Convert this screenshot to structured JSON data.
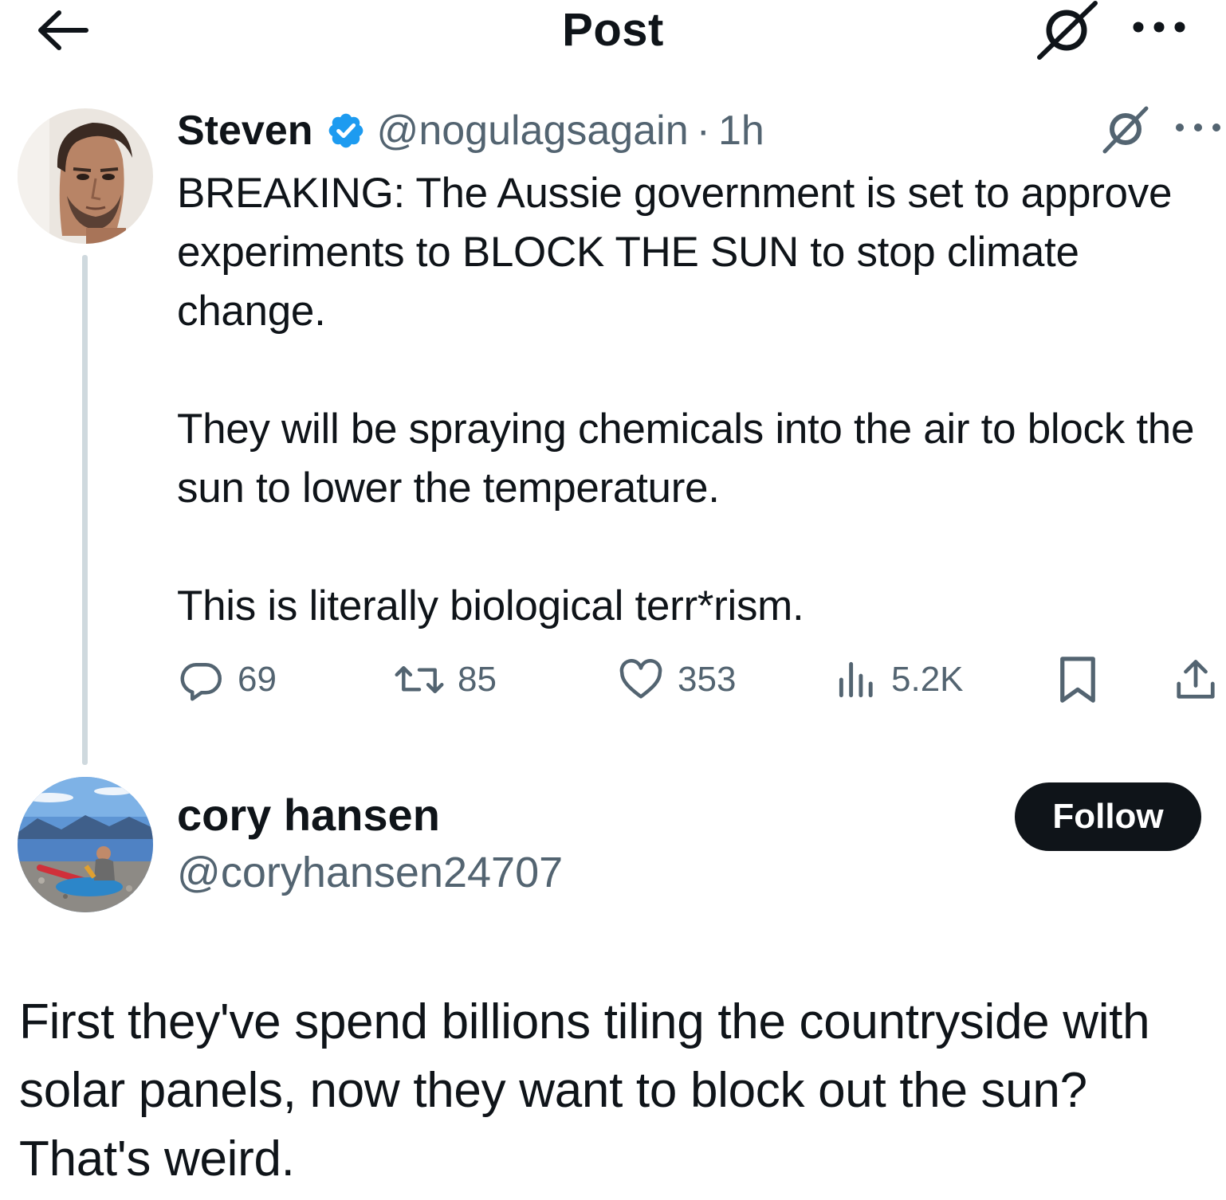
{
  "header": {
    "title": "Post",
    "icons": {
      "back": "arrow-left-icon",
      "grok": "grok-icon",
      "more": "more-horizontal-icon"
    }
  },
  "tweet": {
    "author": {
      "display_name": "Steven",
      "handle": "@nogulagsagain",
      "separator": "·",
      "time": "1h",
      "verified_color": "#1d9bf0"
    },
    "body": "BREAKING: The Aussie government is set to approve experiments to BLOCK THE SUN to stop climate change.\n\nThey will be spraying chemicals into the air to block the sun to lower the temperature.\n\nThis is literally biological terr*rism.",
    "stats": {
      "replies": "69",
      "reposts": "85",
      "likes": "353",
      "views": "5.2K"
    }
  },
  "reply": {
    "author": {
      "display_name": "cory hansen",
      "handle": "@coryhansen24707"
    },
    "follow_label": "Follow",
    "body": "First they've spend billions tiling the countryside with solar panels, now they want to block out the sun? That's weird."
  },
  "colors": {
    "text_primary": "#0f1419",
    "text_secondary": "#536471",
    "accent": "#1d9bf0",
    "thread_line": "#cfd9de"
  }
}
